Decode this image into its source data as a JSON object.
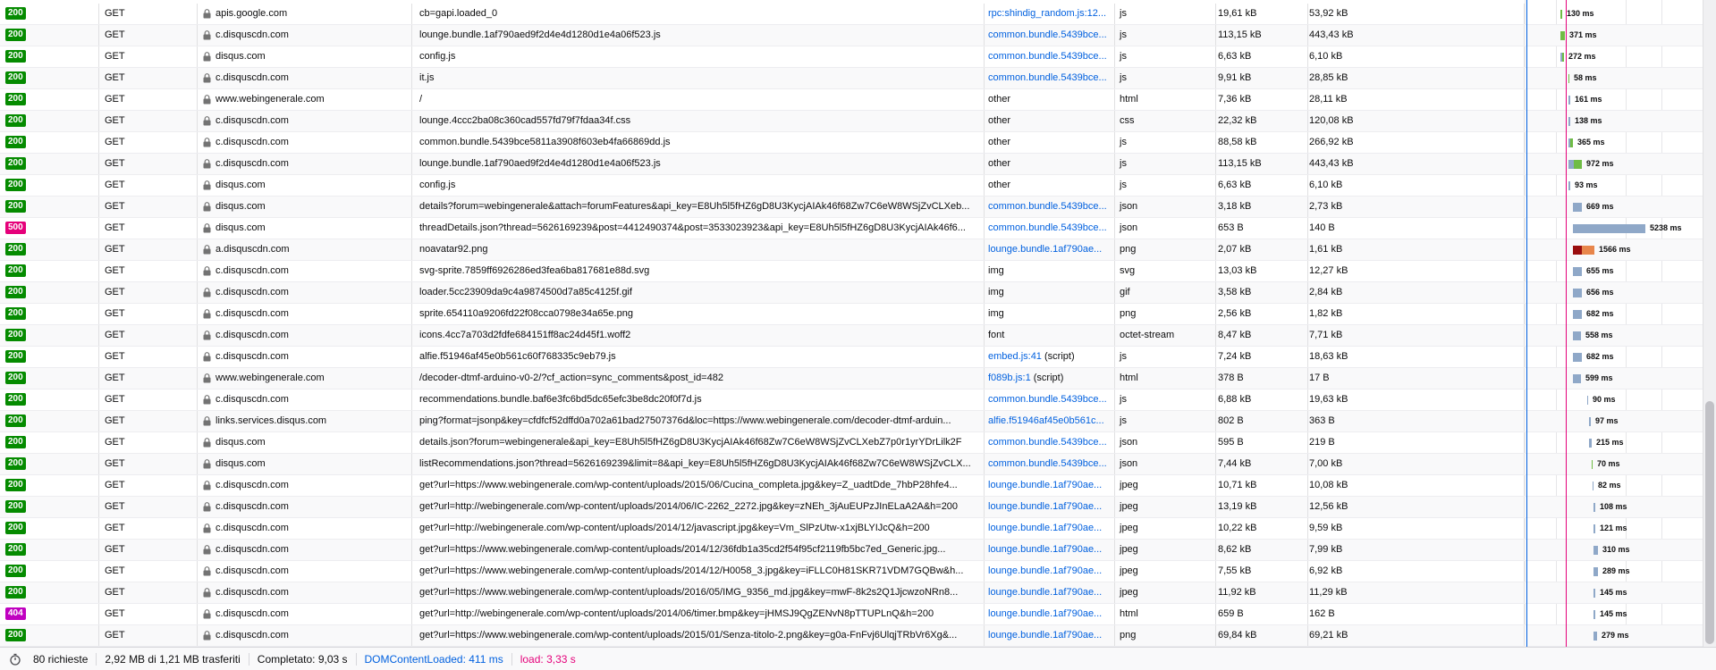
{
  "colors": {
    "status_ok": "#058b00",
    "status_server_error": "#e5007a",
    "status_not_found": "#c000c0",
    "link": "#0060df",
    "bar_default": "#8fa8c8",
    "bar_waiting": "#6fbc45",
    "bar_blocked": "#9a0e0e",
    "bar_orange": "#e8864b",
    "dom_content_loaded": "#0060df",
    "load": "#e5007a"
  },
  "icons": {
    "secure": "lock-icon",
    "timer": "stopwatch-icon"
  },
  "requests": [
    {
      "status": "200",
      "method": "GET",
      "domain": "apis.google.com",
      "file": "cb=gapi.loaded_0",
      "cause": "rpc:shindig_random.js:12...",
      "cause_link": true,
      "type": "js",
      "transferred": "19,61 kB",
      "size": "53,92 kB",
      "start": 1745,
      "width": 2,
      "color": "green",
      "time": "130 ms"
    },
    {
      "status": "200",
      "method": "GET",
      "domain": "c.disquscdn.com",
      "file": "lounge.bundle.1af790aed9f2d4e4d1280d1e4a06f523.js",
      "cause": "common.bundle.5439bce...",
      "cause_link": true,
      "type": "js",
      "transferred": "113,15 kB",
      "size": "443,43 kB",
      "start": 1745,
      "width": 5,
      "color": "green",
      "time": "371 ms"
    },
    {
      "status": "200",
      "method": "GET",
      "domain": "disqus.com",
      "file": "config.js",
      "cause": "common.bundle.5439bce...",
      "cause_link": true,
      "type": "js",
      "transferred": "6,63 kB",
      "size": "6,10 kB",
      "start": 1745,
      "width": 4,
      "color": "mix",
      "time": "272 ms"
    },
    {
      "status": "200",
      "method": "GET",
      "domain": "c.disquscdn.com",
      "file": "it.js",
      "cause": "common.bundle.5439bce...",
      "cause_link": true,
      "type": "js",
      "transferred": "9,91 kB",
      "size": "28,85 kB",
      "start": 1754,
      "width": 1,
      "color": "green",
      "time": "58 ms"
    },
    {
      "status": "200",
      "method": "GET",
      "domain": "www.webingenerale.com",
      "file": "/",
      "cause": "other",
      "cause_link": false,
      "type": "html",
      "transferred": "7,36 kB",
      "size": "28,11 kB",
      "start": 1754,
      "width": 2,
      "color": "blue",
      "time": "161 ms"
    },
    {
      "status": "200",
      "method": "GET",
      "domain": "c.disquscdn.com",
      "file": "lounge.4ccc2ba08c360cad557fd79f7fdaa34f.css",
      "cause": "other",
      "cause_link": false,
      "type": "css",
      "transferred": "22,32 kB",
      "size": "120,08 kB",
      "start": 1754,
      "width": 2,
      "color": "blue",
      "time": "138 ms"
    },
    {
      "status": "200",
      "method": "GET",
      "domain": "c.disquscdn.com",
      "file": "common.bundle.5439bce5811a3908f603eb4fa66869dd.js",
      "cause": "other",
      "cause_link": false,
      "type": "js",
      "transferred": "88,58 kB",
      "size": "266,92 kB",
      "start": 1754,
      "width": 5,
      "color": "mix",
      "time": "365 ms"
    },
    {
      "status": "200",
      "method": "GET",
      "domain": "c.disquscdn.com",
      "file": "lounge.bundle.1af790aed9f2d4e4d1280d1e4a06f523.js",
      "cause": "other",
      "cause_link": false,
      "type": "js",
      "transferred": "113,15 kB",
      "size": "443,43 kB",
      "start": 1754,
      "width": 15,
      "color": "mix",
      "time": "972 ms"
    },
    {
      "status": "200",
      "method": "GET",
      "domain": "disqus.com",
      "file": "config.js",
      "cause": "other",
      "cause_link": false,
      "type": "js",
      "transferred": "6,63 kB",
      "size": "6,10 kB",
      "start": 1754,
      "width": 2,
      "color": "blue",
      "time": "93 ms"
    },
    {
      "status": "200",
      "method": "GET",
      "domain": "disqus.com",
      "file": "details?forum=webingenerale&attach=forumFeatures&api_key=E8Uh5l5fHZ6gD8U3KycjAIAk46f68Zw7C6eW8WSjZvCLXeb...",
      "cause": "common.bundle.5439bce...",
      "cause_link": true,
      "type": "json",
      "transferred": "3,18 kB",
      "size": "2,73 kB",
      "start": 1759,
      "width": 10,
      "color": "blue",
      "time": "669 ms"
    },
    {
      "status": "500",
      "method": "GET",
      "domain": "disqus.com",
      "file": "threadDetails.json?thread=5626169239&post=4412490374&post=3533023923&api_key=E8Uh5l5fHZ6gD8U3KycjAIAk46f6...",
      "cause": "common.bundle.5439bce...",
      "cause_link": true,
      "type": "json",
      "transferred": "653 B",
      "size": "140 B",
      "start": 1759,
      "width": 81,
      "color": "blue",
      "time": "5238 ms"
    },
    {
      "status": "200",
      "method": "GET",
      "domain": "a.disquscdn.com",
      "file": "noavatar92.png",
      "cause": "lounge.bundle.1af790ae...",
      "cause_link": true,
      "type": "png",
      "transferred": "2,07 kB",
      "size": "1,61 kB",
      "start": 1759,
      "width": 24,
      "color": "redmix",
      "time": "1566 ms"
    },
    {
      "status": "200",
      "method": "GET",
      "domain": "c.disquscdn.com",
      "file": "svg-sprite.7859ff6926286ed3fea6ba817681e88d.svg",
      "cause": "img",
      "cause_link": false,
      "type": "svg",
      "transferred": "13,03 kB",
      "size": "12,27 kB",
      "start": 1759,
      "width": 10,
      "color": "blue",
      "time": "655 ms"
    },
    {
      "status": "200",
      "method": "GET",
      "domain": "c.disquscdn.com",
      "file": "loader.5cc23909da9c4a9874500d7a85c4125f.gif",
      "cause": "img",
      "cause_link": false,
      "type": "gif",
      "transferred": "3,58 kB",
      "size": "2,84 kB",
      "start": 1759,
      "width": 10,
      "color": "blue",
      "time": "656 ms"
    },
    {
      "status": "200",
      "method": "GET",
      "domain": "c.disquscdn.com",
      "file": "sprite.654110a9206fd22f08cca0798e34a65e.png",
      "cause": "img",
      "cause_link": false,
      "type": "png",
      "transferred": "2,56 kB",
      "size": "1,82 kB",
      "start": 1759,
      "width": 10,
      "color": "blue",
      "time": "682 ms"
    },
    {
      "status": "200",
      "method": "GET",
      "domain": "c.disquscdn.com",
      "file": "icons.4cc7a703d2fdfe684151ff8ac24d45f1.woff2",
      "cause": "font",
      "cause_link": false,
      "type": "octet-stream",
      "transferred": "8,47 kB",
      "size": "7,71 kB",
      "start": 1759,
      "width": 9,
      "color": "blue",
      "time": "558 ms"
    },
    {
      "status": "200",
      "method": "GET",
      "domain": "c.disquscdn.com",
      "file": "alfie.f51946af45e0b561c60f768335c9eb79.js",
      "cause": "embed.js:41 (script)",
      "cause_link": "partial",
      "cause_link_text": "embed.js:41",
      "cause_rest": " (script)",
      "type": "js",
      "transferred": "7,24 kB",
      "size": "18,63 kB",
      "start": 1759,
      "width": 10,
      "color": "blue",
      "time": "682 ms"
    },
    {
      "status": "200",
      "method": "GET",
      "domain": "www.webingenerale.com",
      "file": "/decoder-dtmf-arduino-v0-2/?cf_action=sync_comments&post_id=482",
      "cause": "f089b.js:1 (script)",
      "cause_link": "partial",
      "cause_link_text": "f089b.js:1",
      "cause_rest": " (script)",
      "type": "html",
      "transferred": "378 B",
      "size": "17 B",
      "start": 1759,
      "width": 9,
      "color": "blue",
      "time": "599 ms"
    },
    {
      "status": "200",
      "method": "GET",
      "domain": "c.disquscdn.com",
      "file": "recommendations.bundle.baf6e3fc6bd5dc65efc3be8dc20f0f7d.js",
      "cause": "common.bundle.5439bce...",
      "cause_link": true,
      "type": "js",
      "transferred": "6,88 kB",
      "size": "19,63 kB",
      "start": 1775,
      "width": 1,
      "color": "blue",
      "time": "90 ms"
    },
    {
      "status": "200",
      "method": "GET",
      "domain": "links.services.disqus.com",
      "file": "ping?format=jsonp&key=cfdfcf52dffd0a702a61bad27507376d&loc=https://www.webingenerale.com/decoder-dtmf-arduin...",
      "cause": "alfie.f51946af45e0b561c...",
      "cause_link": true,
      "type": "js",
      "transferred": "802 B",
      "size": "363 B",
      "start": 1777,
      "width": 2,
      "color": "blue",
      "time": "97 ms"
    },
    {
      "status": "200",
      "method": "GET",
      "domain": "disqus.com",
      "file": "details.json?forum=webingenerale&api_key=E8Uh5l5fHZ6gD8U3KycjAIAk46f68Zw7C6eW8WSjZvCLXebZ7p0r1yrYDrLilk2F",
      "cause": "common.bundle.5439bce...",
      "cause_link": true,
      "type": "json",
      "transferred": "595 B",
      "size": "219 B",
      "start": 1777,
      "width": 3,
      "color": "blue",
      "time": "215 ms"
    },
    {
      "status": "200",
      "method": "GET",
      "domain": "disqus.com",
      "file": "listRecommendations.json?thread=5626169239&limit=8&api_key=E8Uh5l5fHZ6gD8U3KycjAIAk46f68Zw7C6eW8WSjZvCLX...",
      "cause": "common.bundle.5439bce...",
      "cause_link": true,
      "type": "json",
      "transferred": "7,44 kB",
      "size": "7,00 kB",
      "start": 1780,
      "width": 1,
      "color": "green",
      "time": "70 ms"
    },
    {
      "status": "200",
      "method": "GET",
      "domain": "c.disquscdn.com",
      "file": "get?url=https://www.webingenerale.com/wp-content/uploads/2015/06/Cucina_completa.jpg&key=Z_uadtDde_7hbP28hfe4...",
      "cause": "lounge.bundle.1af790ae...",
      "cause_link": true,
      "type": "jpeg",
      "transferred": "10,71 kB",
      "size": "10,08 kB",
      "start": 1781,
      "width": 1,
      "color": "blue",
      "time": "82 ms"
    },
    {
      "status": "200",
      "method": "GET",
      "domain": "c.disquscdn.com",
      "file": "get?url=http://webingenerale.com/wp-content/uploads/2014/06/IC-2262_2272.jpg&key=zNEh_3jAuEUPzJInELaA2A&h=200",
      "cause": "lounge.bundle.1af790ae...",
      "cause_link": true,
      "type": "jpeg",
      "transferred": "13,19 kB",
      "size": "12,56 kB",
      "start": 1782,
      "width": 2,
      "color": "blue",
      "time": "108 ms"
    },
    {
      "status": "200",
      "method": "GET",
      "domain": "c.disquscdn.com",
      "file": "get?url=http://webingenerale.com/wp-content/uploads/2014/12/javascript.jpg&key=Vm_SlPzUtw-x1xjBLYIJcQ&h=200",
      "cause": "lounge.bundle.1af790ae...",
      "cause_link": true,
      "type": "jpeg",
      "transferred": "10,22 kB",
      "size": "9,59 kB",
      "start": 1782,
      "width": 2,
      "color": "blue",
      "time": "121 ms"
    },
    {
      "status": "200",
      "method": "GET",
      "domain": "c.disquscdn.com",
      "file": "get?url=https://www.webingenerale.com/wp-content/uploads/2014/12/36fdb1a35cd2f54f95cf2119fb5bc7ed_Generic.jpg...",
      "cause": "lounge.bundle.1af790ae...",
      "cause_link": true,
      "type": "jpeg",
      "transferred": "8,62 kB",
      "size": "7,99 kB",
      "start": 1782,
      "width": 5,
      "color": "blue",
      "time": "310 ms"
    },
    {
      "status": "200",
      "method": "GET",
      "domain": "c.disquscdn.com",
      "file": "get?url=https://www.webingenerale.com/wp-content/uploads/2014/12/H0058_3.jpg&key=iFLLC0H81SKR71VDM7GQBw&h...",
      "cause": "lounge.bundle.1af790ae...",
      "cause_link": true,
      "type": "jpeg",
      "transferred": "7,55 kB",
      "size": "6,92 kB",
      "start": 1782,
      "width": 5,
      "color": "blue",
      "time": "289 ms"
    },
    {
      "status": "200",
      "method": "GET",
      "domain": "c.disquscdn.com",
      "file": "get?url=https://www.webingenerale.com/wp-content/uploads/2016/05/IMG_9356_md.jpg&key=mwF-8k2s2Q1JjcwzoNRn8...",
      "cause": "lounge.bundle.1af790ae...",
      "cause_link": true,
      "type": "jpeg",
      "transferred": "11,92 kB",
      "size": "11,29 kB",
      "start": 1782,
      "width": 2,
      "color": "blue",
      "time": "145 ms"
    },
    {
      "status": "404",
      "method": "GET",
      "domain": "c.disquscdn.com",
      "file": "get?url=http://webingenerale.com/wp-content/uploads/2014/06/timer.bmp&key=jHMSJ9QgZENvN8pTTUPLnQ&h=200",
      "cause": "lounge.bundle.1af790ae...",
      "cause_link": true,
      "type": "html",
      "transferred": "659 B",
      "size": "162 B",
      "start": 1782,
      "width": 2,
      "color": "blue",
      "time": "145 ms"
    },
    {
      "status": "200",
      "method": "GET",
      "domain": "c.disquscdn.com",
      "file": "get?url=https://www.webingenerale.com/wp-content/uploads/2015/01/Senza-titolo-2.png&key=g0a-FnFvj6UlqjTRbVr6Xg&...",
      "cause": "lounge.bundle.1af790ae...",
      "cause_link": true,
      "type": "png",
      "transferred": "69,84 kB",
      "size": "69,21 kB",
      "start": 1782,
      "width": 4,
      "color": "blue",
      "time": "279 ms"
    }
  ],
  "status_bar": {
    "requests": "80 richieste",
    "transferred": "2,92 MB di 1,21 MB trasferiti",
    "finish": "Completato: 9,03 s",
    "dom_content_loaded": "DOMContentLoaded: 411 ms",
    "load": "load: 3,33 s"
  }
}
